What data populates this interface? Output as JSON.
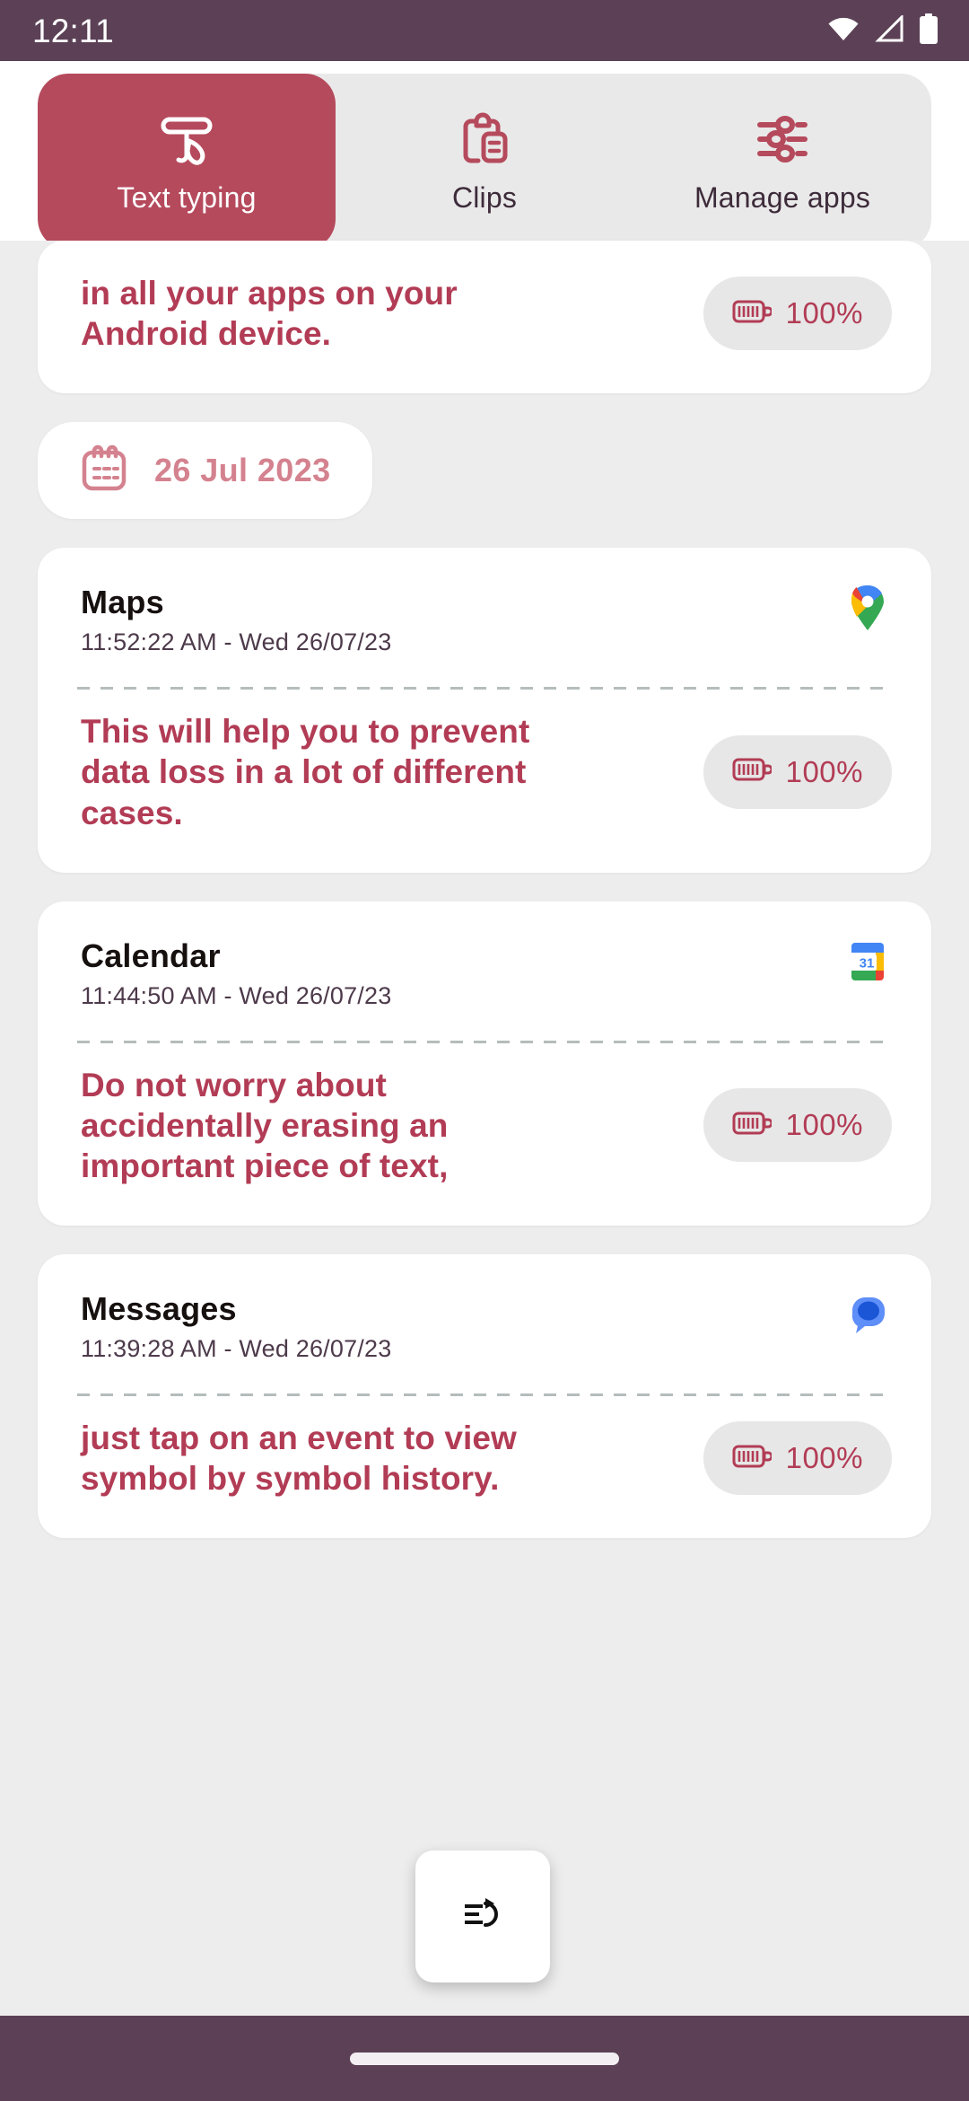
{
  "status_bar": {
    "clock": "12:11",
    "icons": [
      "wifi-icon",
      "cell-signal-icon",
      "battery-icon"
    ]
  },
  "tabs": [
    {
      "label": "Text typing",
      "icon": "text-typing-icon",
      "active": true
    },
    {
      "label": "Clips",
      "icon": "clipboard-icon",
      "active": false
    },
    {
      "label": "Manage apps",
      "icon": "sliders-icon",
      "active": false
    }
  ],
  "partial_card": {
    "snippet": "in all your apps on your Android device.",
    "battery": "100%"
  },
  "date_chip": {
    "icon": "calendar-icon",
    "label": "26 Jul 2023"
  },
  "entries": [
    {
      "app_name": "Maps",
      "timestamp": "11:52:22 AM - Wed 26/07/23",
      "icon": "google-maps-icon",
      "snippet": "This will help you to prevent data loss in a lot of different cases.",
      "battery": "100%"
    },
    {
      "app_name": "Calendar",
      "timestamp": "11:44:50 AM - Wed 26/07/23",
      "icon": "google-calendar-icon",
      "snippet": "Do not worry about accidentally erasing an important piece of text,",
      "battery": "100%"
    },
    {
      "app_name": "Messages",
      "timestamp": "11:39:28 AM - Wed 26/07/23",
      "icon": "google-messages-icon",
      "snippet": "just tap on an event to view symbol by symbol history.",
      "battery": "100%"
    }
  ],
  "floating_button": {
    "icon": "restore-text-icon"
  },
  "nav_bar": {
    "gesture_pill": "home-gesture-pill"
  },
  "colors": {
    "accent_red": "#b54a5c",
    "snippet_red": "#b23c55",
    "date_pink": "#d4828f",
    "status_bar": "#5c4156",
    "page_bg": "#ededed",
    "card_bg": "#ffffff"
  }
}
